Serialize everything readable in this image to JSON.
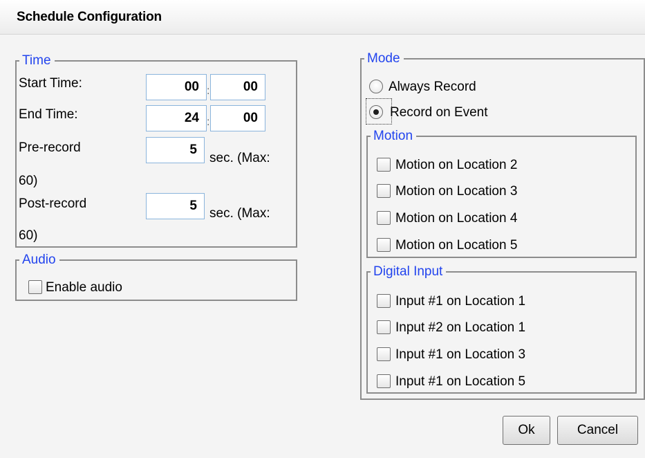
{
  "dialog": {
    "title": "Schedule Configuration"
  },
  "time": {
    "legend": "Time",
    "start_label": "Start Time:",
    "start_hour": "00",
    "start_minute": "00",
    "end_label": "End Time:",
    "end_hour": "24",
    "end_minute": "00",
    "separator": ":",
    "prerecord_label": "Pre-record",
    "prerecord_value": "5",
    "prerecord_unit": "sec. (Max:",
    "prerecord_max": "60)",
    "postrecord_label": "Post-record",
    "postrecord_value": "5",
    "postrecord_unit": "sec. (Max:",
    "postrecord_max": "60)"
  },
  "audio": {
    "legend": "Audio",
    "enable_label": "Enable audio",
    "enabled": false
  },
  "mode": {
    "legend": "Mode",
    "options": [
      {
        "label": "Always Record",
        "selected": false
      },
      {
        "label": "Record on Event",
        "selected": true
      }
    ]
  },
  "motion": {
    "legend": "Motion",
    "items": [
      {
        "label": "Motion on Location 2",
        "checked": false
      },
      {
        "label": "Motion on Location 3",
        "checked": false
      },
      {
        "label": "Motion on Location 4",
        "checked": false
      },
      {
        "label": "Motion on Location 5",
        "checked": false
      }
    ]
  },
  "digital_input": {
    "legend": "Digital Input",
    "items": [
      {
        "label": "Input #1 on Location 1",
        "checked": false
      },
      {
        "label": "Input #2 on Location 1",
        "checked": false
      },
      {
        "label": "Input #1 on Location 3",
        "checked": false
      },
      {
        "label": "Input #1 on Location 5",
        "checked": false
      }
    ]
  },
  "buttons": {
    "ok": "Ok",
    "cancel": "Cancel"
  },
  "colors": {
    "legend": "#2244ee",
    "input_border": "#8ab4dc",
    "group_border": "#8c8c8c"
  }
}
